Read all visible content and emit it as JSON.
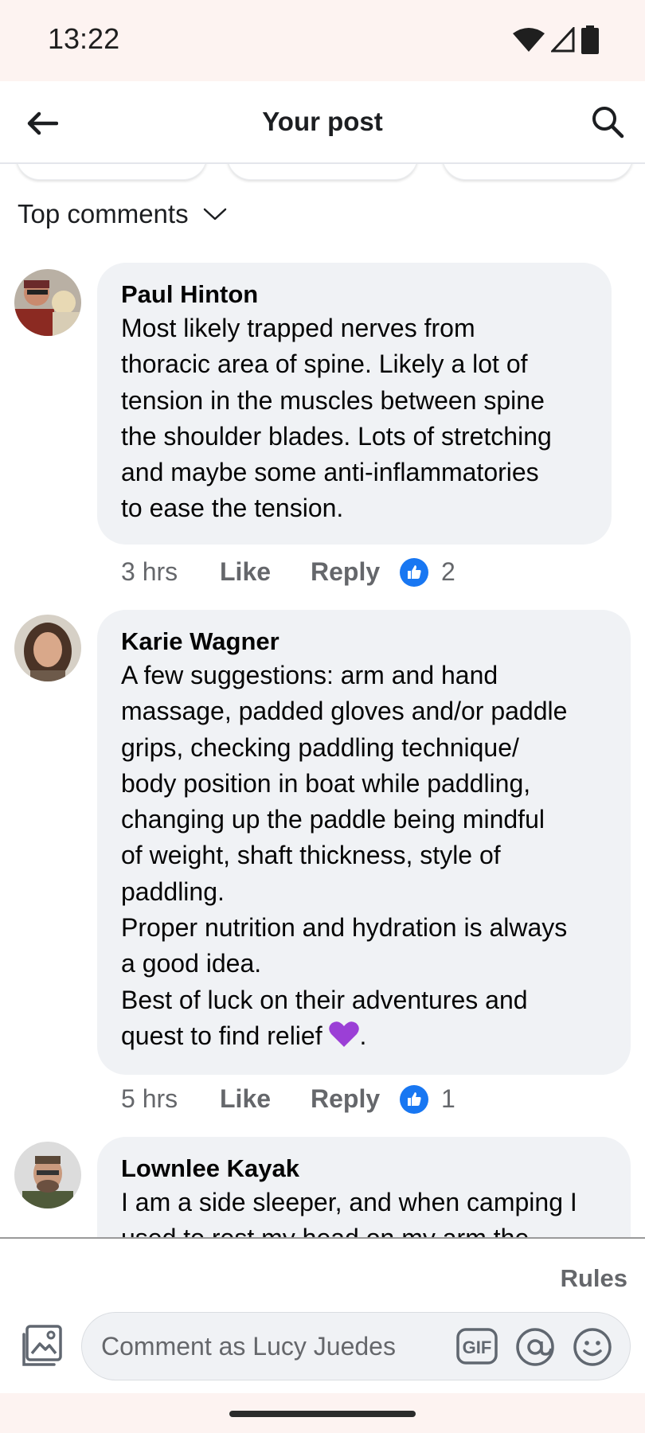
{
  "status_bar": {
    "time": "13:22"
  },
  "header": {
    "title": "Your post"
  },
  "sort": {
    "label": "Top comments"
  },
  "comments": [
    {
      "author": "Paul Hinton",
      "text": "Most likely trapped nerves from\nthoracic area of spine. Likely a lot of\ntension in the muscles between spine\nthe shoulder blades. Lots of stretching\nand maybe some anti-inflammatories\nto ease the tension.",
      "age": "3 hrs",
      "like_label": "Like",
      "reply_label": "Reply",
      "reaction_count": "2"
    },
    {
      "author": "Karie Wagner",
      "text": "A few suggestions: arm and hand\nmassage, padded gloves and/or paddle\ngrips, checking paddling technique/\nbody position in boat while paddling,\nchanging up the paddle being mindful\nof weight, shaft thickness, style of\npaddling.\nProper nutrition and hydration is always\na good idea.\nBest of luck on their adventures and\nquest to find relief",
      "text_suffix": ".",
      "age": "5 hrs",
      "like_label": "Like",
      "reply_label": "Reply",
      "reaction_count": "1"
    },
    {
      "author": "Lownlee Kayak",
      "text": "I am a side sleeper, and when camping I\nused to rest my head on my arm the"
    }
  ],
  "composer": {
    "rules_label": "Rules",
    "placeholder": "Comment as Lucy Juedes",
    "gif_label": "GIF"
  },
  "colors": {
    "accent": "#1877f2",
    "bubble": "#f0f2f5",
    "secondary_text": "#65676b",
    "heart": "#9b3fd6"
  }
}
